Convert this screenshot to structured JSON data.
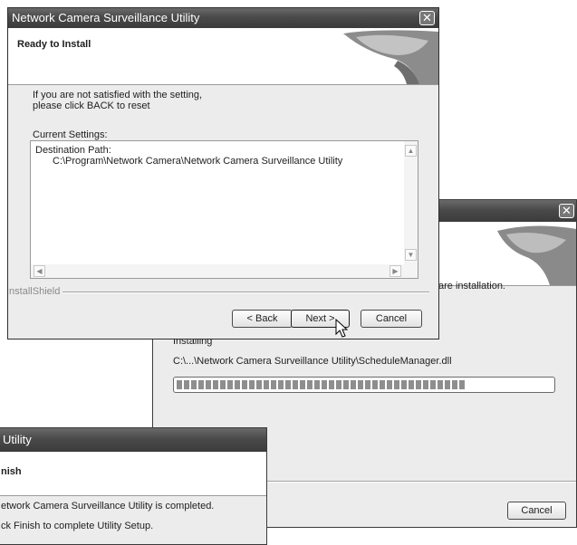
{
  "window_install": {
    "title": "Network Camera Surveillance Utility",
    "header_title": "Ready to Install",
    "instructions_line1": "If you are not satisfied with the setting,",
    "instructions_line2": "please click BACK to reset",
    "current_settings_label": "Current Settings:",
    "settings_line1": "Destination Path:",
    "settings_line2": "C:\\Program\\Network Camera\\Network Camera Surveillance Utility",
    "brand_label": "InstallShield",
    "back_label": "< Back",
    "next_label": "Next >",
    "cancel_label": "Cancel",
    "close_glyph": "✕"
  },
  "window_progress": {
    "close_glyph": "✕",
    "status_partial": "are installation.",
    "installing_label": "Installing",
    "file_path": "C:\\...\\Network Camera Surveillance Utility\\ScheduleManager.dll",
    "progress_fraction": 0.77,
    "cancel_label": "Cancel"
  },
  "window_finish": {
    "title_partial": "Utility",
    "header_partial": "nish",
    "line1_partial": "etwork Camera Surveillance Utility is completed.",
    "line2_partial": "ck Finish to complete Utility Setup."
  }
}
